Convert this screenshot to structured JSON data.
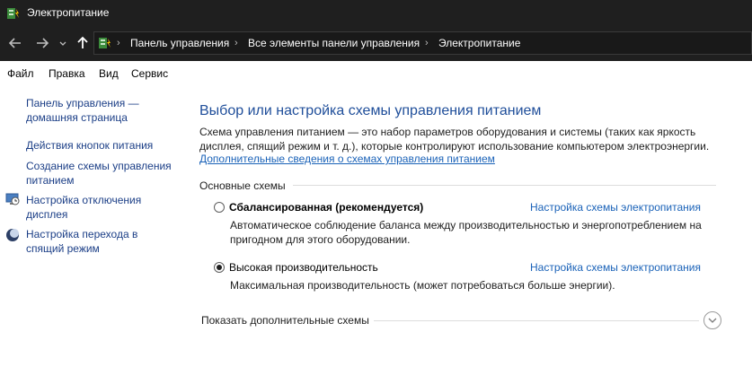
{
  "window": {
    "title": "Электропитание"
  },
  "breadcrumbs": [
    {
      "label": "Панель управления"
    },
    {
      "label": "Все элементы панели управления"
    },
    {
      "label": "Электропитание"
    }
  ],
  "menu": [
    "Файл",
    "Правка",
    "Вид",
    "Сервис"
  ],
  "sidebar": {
    "home_link": "Панель управления — домашняя страница",
    "items": [
      {
        "label": "Действия кнопок питания"
      },
      {
        "label": "Создание схемы управления питанием"
      },
      {
        "label": "Настройка отключения дисплея"
      },
      {
        "label": "Настройка перехода в спящий режим"
      }
    ]
  },
  "main": {
    "heading": "Выбор или настройка схемы управления питанием",
    "description": "Схема управления питанием — это набор параметров оборудования и системы (таких как яркость дисплея, спящий режим и т. д.), которые контролируют использование компьютером электроэнергии.",
    "more_info_link": "Дополнительные сведения о схемах управления питанием",
    "group_title": "Основные схемы",
    "plans": [
      {
        "name": "Сбалансированная (рекомендуется)",
        "selected": false,
        "settings_link": "Настройка схемы электропитания",
        "description": "Автоматическое соблюдение баланса между производительностью и энергопотреблением на пригодном для этого оборудовании."
      },
      {
        "name": "Высокая производительность",
        "selected": true,
        "settings_link": "Настройка схемы электропитания",
        "description": "Максимальная производительность (может потребоваться больше энергии)."
      }
    ],
    "show_more": "Показать дополнительные схемы"
  },
  "icons": {
    "back": "back-arrow-icon",
    "forward": "forward-arrow-icon",
    "recent": "chevron-down-icon",
    "up": "up-arrow-icon",
    "power_options": "power-options-icon",
    "display": "display-clock-icon",
    "sleep": "moon-icon",
    "expand": "chevron-down-icon"
  },
  "colors": {
    "titlebar": "#1f1f1f",
    "heading": "#1f4e9a",
    "link": "#1a62b8",
    "sidebar_link": "#1c3f87"
  }
}
